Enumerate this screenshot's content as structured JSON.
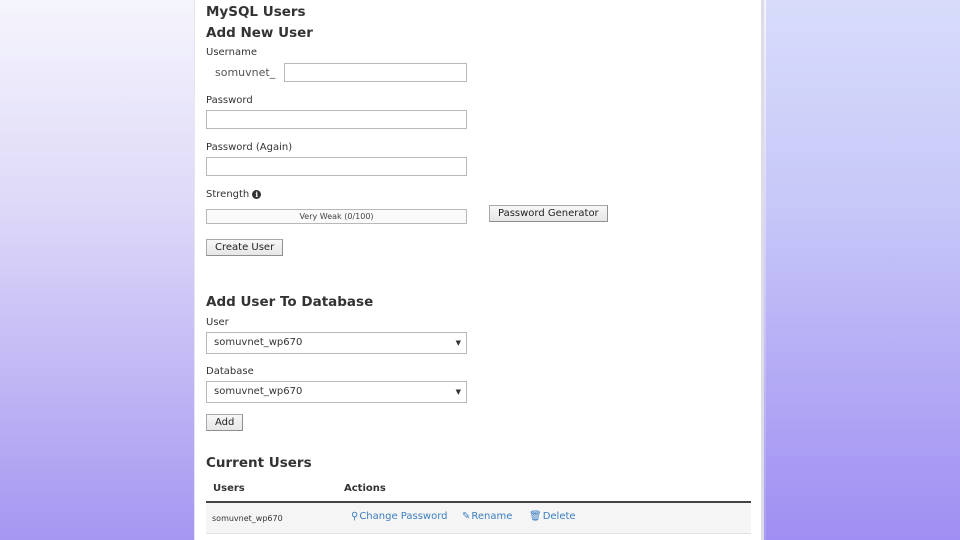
{
  "page": {
    "title": "MySQL Users"
  },
  "add_user": {
    "heading": "Add New User",
    "username_label": "Username",
    "username_prefix": "somuvnet_",
    "username_value": "",
    "password_label": "Password",
    "password_value": "",
    "password_again_label": "Password (Again)",
    "password_again_value": "",
    "strength_label": "Strength",
    "strength_info_icon": "info-icon",
    "strength_text": "Very Weak (0/100)",
    "strength_percent": 0,
    "generator_button": "Password Generator",
    "create_button": "Create User"
  },
  "add_to_db": {
    "heading": "Add User To Database",
    "user_label": "User",
    "user_selected": "somuvnet_wp670",
    "database_label": "Database",
    "database_selected": "somuvnet_wp670",
    "add_button": "Add"
  },
  "current_users": {
    "heading": "Current Users",
    "columns": [
      "Users",
      "Actions"
    ],
    "rows": [
      {
        "user": "somuvnet_wp670",
        "actions": {
          "change_password": "Change Password",
          "rename": "Rename",
          "delete": "Delete"
        }
      }
    ]
  },
  "icons": {
    "change_password": "key-icon",
    "rename": "pencil-icon",
    "delete": "trash-icon",
    "dropdown": "caret-down-icon"
  },
  "colors": {
    "link": "#3b7ec0",
    "heading": "#333333"
  }
}
